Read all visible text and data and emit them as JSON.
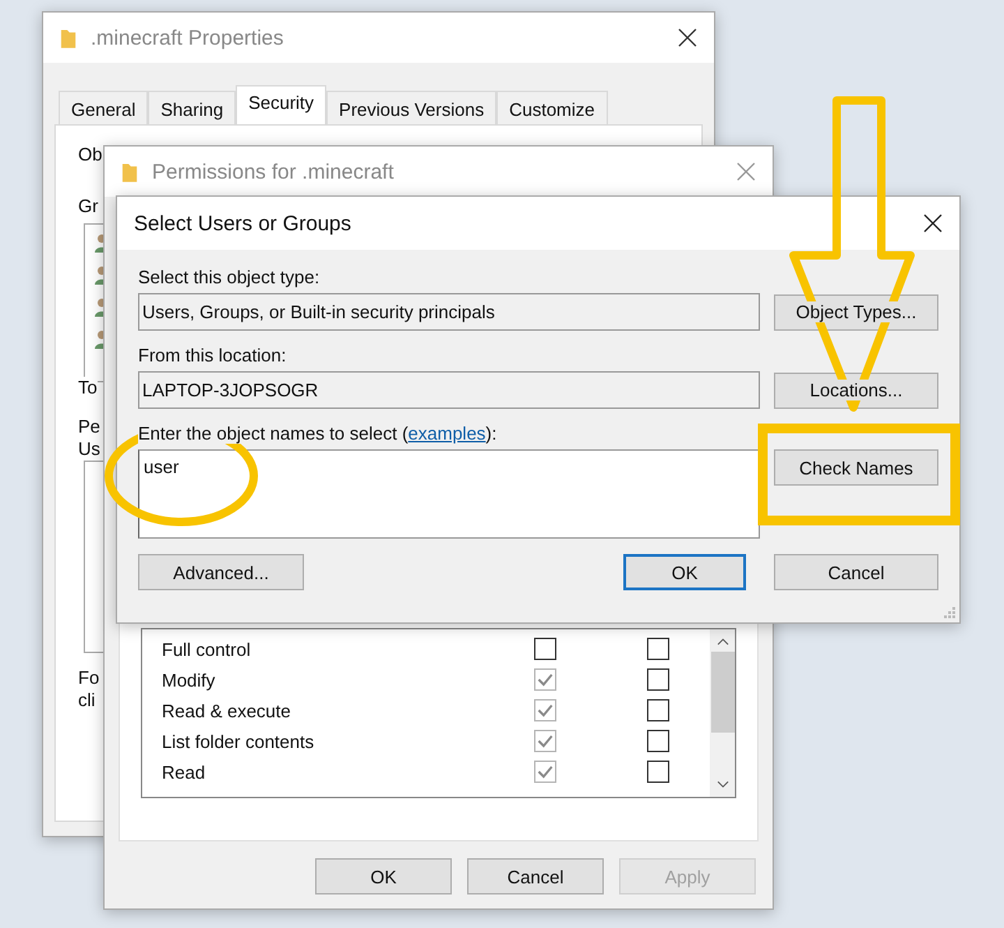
{
  "properties_window": {
    "title": ".minecraft Properties",
    "tabs": [
      {
        "label": "General",
        "selected": false
      },
      {
        "label": "Sharing",
        "selected": false
      },
      {
        "label": "Security",
        "selected": true
      },
      {
        "label": "Previous Versions",
        "selected": false
      },
      {
        "label": "Customize",
        "selected": false
      }
    ],
    "partial_labels": [
      "Ob",
      "Gr",
      "To",
      "Pe",
      "Us",
      "Fo",
      "cli"
    ]
  },
  "permissions_window": {
    "title": "Permissions for .minecraft",
    "permissions": [
      {
        "name": "Full control",
        "allow_checked": false,
        "allow_disabled": false,
        "deny_checked": false
      },
      {
        "name": "Modify",
        "allow_checked": true,
        "allow_disabled": true,
        "deny_checked": false
      },
      {
        "name": "Read & execute",
        "allow_checked": true,
        "allow_disabled": true,
        "deny_checked": false
      },
      {
        "name": "List folder contents",
        "allow_checked": true,
        "allow_disabled": true,
        "deny_checked": false
      },
      {
        "name": "Read",
        "allow_checked": true,
        "allow_disabled": true,
        "deny_checked": false
      }
    ],
    "buttons": [
      {
        "label": "OK",
        "disabled": false
      },
      {
        "label": "Cancel",
        "disabled": false
      },
      {
        "label": "Apply",
        "disabled": true
      }
    ]
  },
  "select_dialog": {
    "title": "Select Users or Groups",
    "object_type_label": "Select this object type:",
    "object_type": "Users, Groups, or Built-in security principals",
    "object_types_button": "Object Types...",
    "location_label": "From this location:",
    "location": "LAPTOP-3JOPSOGR",
    "locations_button": "Locations...",
    "names_label_before": "Enter the object names to select (",
    "names_link": "examples",
    "names_label_after": "):",
    "names_value": "user",
    "check_names_button": "Check Names",
    "advanced_button": "Advanced...",
    "ok_button": "OK",
    "cancel_button": "Cancel"
  },
  "annotations": [
    {
      "kind": "arrow"
    },
    {
      "kind": "rectangle"
    },
    {
      "kind": "ellipse"
    }
  ]
}
